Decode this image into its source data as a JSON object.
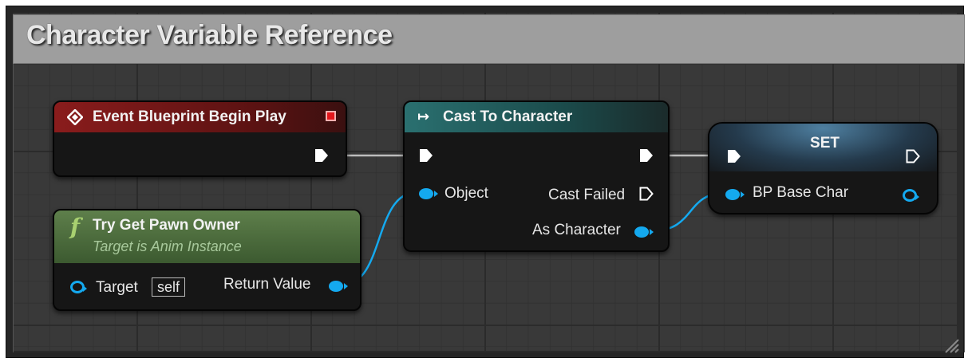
{
  "comment": {
    "title": "Character Variable Reference"
  },
  "nodes": {
    "event_begin_play": {
      "title": "Event Blueprint Begin Play",
      "icon": "diamond-event-icon",
      "header_color": "#7a1a1a"
    },
    "try_get_pawn_owner": {
      "title": "Try Get Pawn Owner",
      "subtitle": "Target is Anim Instance",
      "icon": "function-icon",
      "glyph": "f",
      "header_color": "#4e6e3f",
      "target_label": "Target",
      "target_value": "self",
      "return_label": "Return Value"
    },
    "cast_to_character": {
      "title": "Cast To Character",
      "icon": "cast-arrow-icon",
      "glyph": "↦",
      "header_color": "#1f5a5a",
      "object_label": "Object",
      "cast_failed_label": "Cast Failed",
      "as_character_label": "As Character"
    },
    "set_node": {
      "title": "SET",
      "header_color": "#2a4c66",
      "var_label": "BP Base Char"
    }
  },
  "colors": {
    "object_pin": "#14a9ef",
    "exec_pin": "#ffffff",
    "wire_exec": "#d0d0d0"
  }
}
